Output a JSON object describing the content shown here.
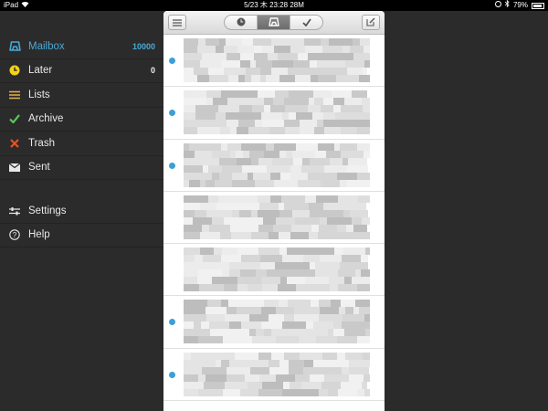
{
  "status_bar": {
    "device": "iPad",
    "time": "5/23 木 23:28 28M",
    "battery": "79%"
  },
  "sidebar": {
    "items": [
      {
        "label": "Mailbox",
        "count": "10000",
        "icon": "mailbox-icon",
        "active": true
      },
      {
        "label": "Later",
        "count": "0",
        "icon": "clock-icon"
      },
      {
        "label": "Lists",
        "count": "",
        "icon": "list-icon"
      },
      {
        "label": "Archive",
        "count": "",
        "icon": "checkmark-icon"
      },
      {
        "label": "Trash",
        "count": "",
        "icon": "x-icon"
      },
      {
        "label": "Sent",
        "count": "",
        "icon": "envelope-icon"
      }
    ],
    "secondary": [
      {
        "label": "Settings",
        "icon": "sliders-icon"
      },
      {
        "label": "Help",
        "icon": "help-icon"
      }
    ]
  },
  "toolbar": {
    "segments": [
      "clock-icon",
      "mailbox-icon",
      "checkmark-icon"
    ],
    "selected_segment": 1
  },
  "messages": [
    {
      "unread": true
    },
    {
      "unread": true
    },
    {
      "unread": true
    },
    {
      "unread": false
    },
    {
      "unread": false
    },
    {
      "unread": true
    },
    {
      "unread": true
    }
  ],
  "colors": {
    "accent": "#4aa8d8",
    "sidebar_bg": "#2b2b2b",
    "unread_dot": "#3d9fd4",
    "later": "#f2d21b",
    "lists": "#e6b24a",
    "archive": "#5cc55c",
    "trash": "#e2522a"
  }
}
